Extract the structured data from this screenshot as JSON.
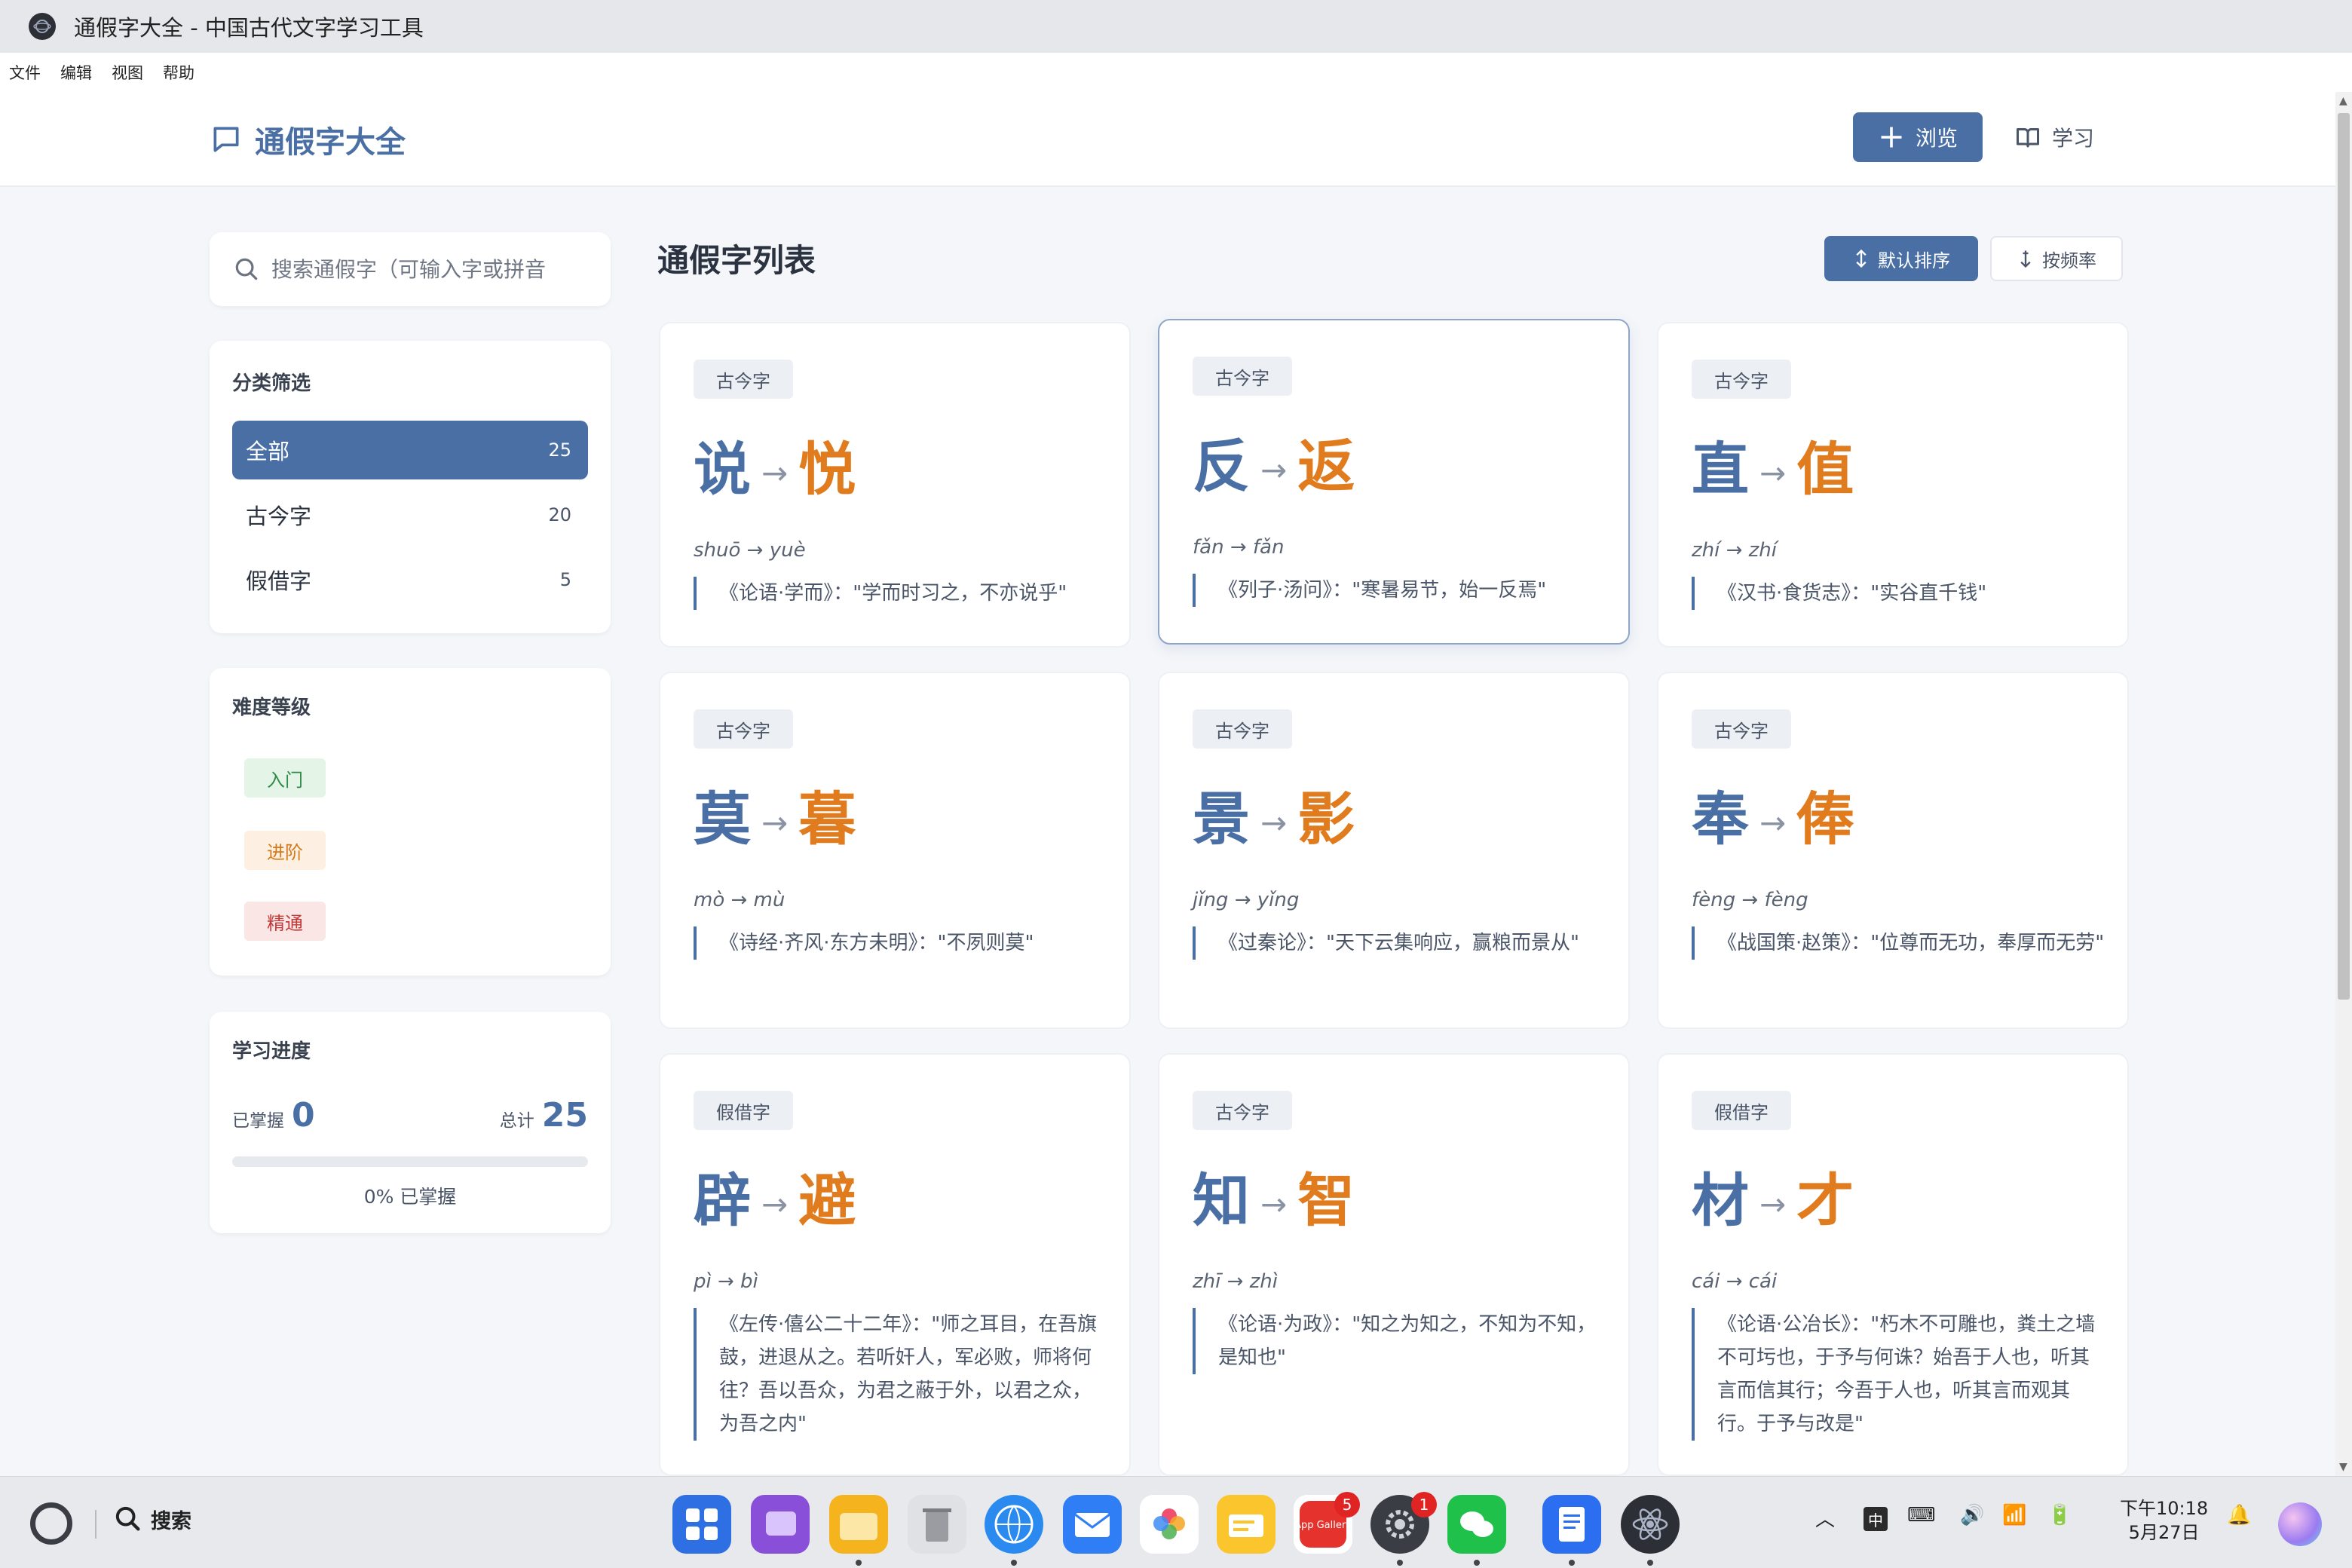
{
  "window": {
    "title": "通假字大全 - 中国古代文字学习工具"
  },
  "menubar": [
    "文件",
    "编辑",
    "视图",
    "帮助"
  ],
  "header": {
    "brand": "通假字大全",
    "nav_browse": "浏览",
    "nav_study": "学习",
    "accent_color": "#4a6fa5"
  },
  "search": {
    "placeholder": "搜索通假字（可输入字或拼音"
  },
  "category": {
    "title": "分类筛选",
    "items": [
      {
        "label": "全部",
        "count": "25"
      },
      {
        "label": "古今字",
        "count": "20"
      },
      {
        "label": "假借字",
        "count": "5"
      }
    ]
  },
  "difficulty": {
    "title": "难度等级",
    "levels": [
      "入门",
      "进阶",
      "精通"
    ]
  },
  "progress": {
    "title": "学习进度",
    "mastered_label": "已掌握",
    "mastered": "0",
    "total_label": "总计",
    "total": "25",
    "percent_text": "0% 已掌握",
    "fraction": 0
  },
  "main": {
    "title": "通假字列表",
    "sort_default": "默认排序",
    "sort_freq": "按频率"
  },
  "cards": [
    {
      "tag": "古今字",
      "old": "说",
      "arrow": "→",
      "new": "悦",
      "pinyin": "shuō → yuè",
      "quote": "《论语·学而》：\"学而时习之，不亦说乎\""
    },
    {
      "tag": "古今字",
      "old": "反",
      "arrow": "→",
      "new": "返",
      "pinyin": "fǎn → fǎn",
      "quote": "《列子·汤问》：\"寒暑易节，始一反焉\""
    },
    {
      "tag": "古今字",
      "old": "直",
      "arrow": "→",
      "new": "值",
      "pinyin": "zhí → zhí",
      "quote": "《汉书·食货志》：\"实谷直千钱\""
    },
    {
      "tag": "古今字",
      "old": "莫",
      "arrow": "→",
      "new": "暮",
      "pinyin": "mò → mù",
      "quote": "《诗经·齐风·东方未明》：\"不夙则莫\""
    },
    {
      "tag": "古今字",
      "old": "景",
      "arrow": "→",
      "new": "影",
      "pinyin": "jǐng → yǐng",
      "quote": "《过秦论》：\"天下云集响应，赢粮而景从\""
    },
    {
      "tag": "古今字",
      "old": "奉",
      "arrow": "→",
      "new": "俸",
      "pinyin": "fèng → fèng",
      "quote": "《战国策·赵策》：\"位尊而无功，奉厚而无劳\""
    },
    {
      "tag": "假借字",
      "old": "辟",
      "arrow": "→",
      "new": "避",
      "pinyin": "pì → bì",
      "quote": "《左传·僖公二十二年》：\"师之耳目，在吾旗鼓，进退从之。若听奸人，军必败，师将何往？吾以吾众，为君之蔽于外，以君之众，为吾之内\""
    },
    {
      "tag": "古今字",
      "old": "知",
      "arrow": "→",
      "new": "智",
      "pinyin": "zhī → zhì",
      "quote": "《论语·为政》：\"知之为知之，不知为不知，是知也\""
    },
    {
      "tag": "假借字",
      "old": "材",
      "arrow": "→",
      "new": "才",
      "pinyin": "cái → cái",
      "quote": "《论语·公冶长》：\"朽木不可雕也，粪土之墙不可圬也，于予与何诛？始吾于人也，听其言而信其行；今吾于人也，听其言而观其行。于予与改是\""
    }
  ],
  "taskbar": {
    "search_label": "搜索",
    "app_gallery_label": "App Gallery",
    "badge_gallery": "5",
    "badge_settings": "1",
    "ime": "中",
    "time": "下午10:18",
    "date": "5月27日"
  }
}
